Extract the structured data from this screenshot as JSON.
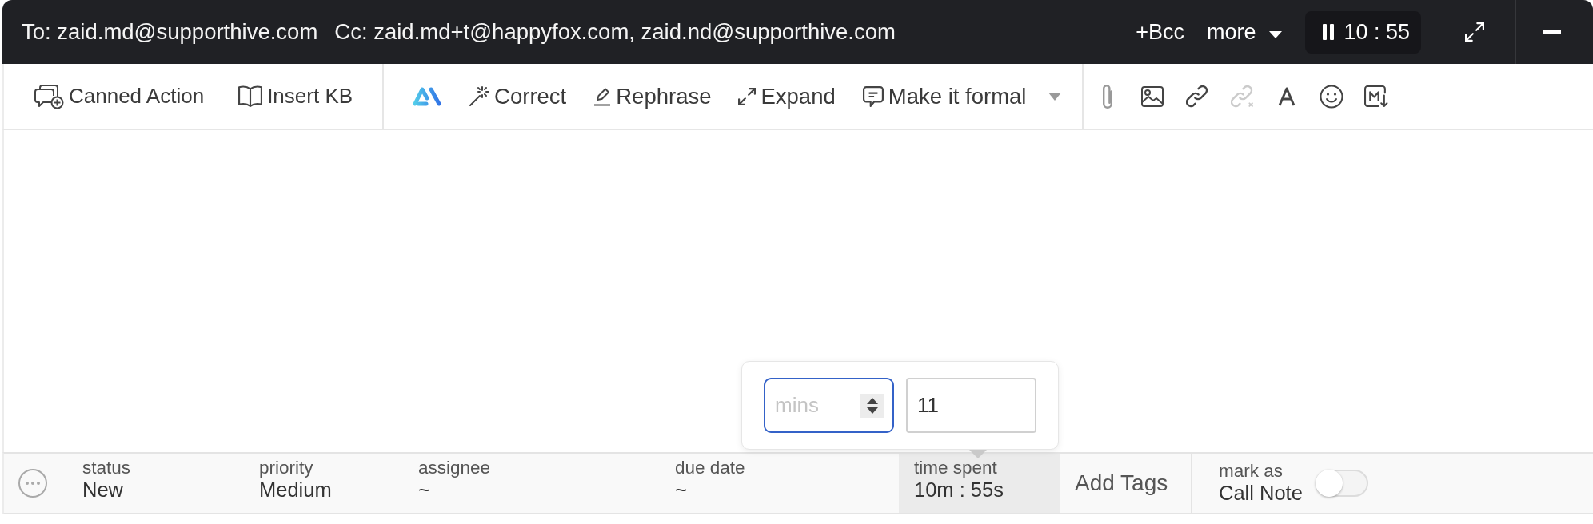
{
  "header": {
    "to": "To: zaid.md@supporthive.com",
    "cc": "Cc: zaid.md+t@happyfox.com, zaid.nd@supporthive.com",
    "bcc": "+Bcc",
    "more": "more",
    "timer": "10 : 55"
  },
  "toolbar": {
    "actions": [
      {
        "label": "Canned Action"
      },
      {
        "label": "Insert KB"
      }
    ],
    "ai_actions": [
      {
        "label": "Correct"
      },
      {
        "label": "Rephrase"
      },
      {
        "label": "Expand"
      },
      {
        "label": "Make it formal"
      }
    ],
    "format_tools": [
      {
        "disabled": false
      },
      {
        "disabled": false
      },
      {
        "disabled": false
      },
      {
        "disabled": true
      },
      {
        "disabled": false
      },
      {
        "disabled": false
      },
      {
        "disabled": false
      }
    ]
  },
  "ticket_fields": [
    {
      "label": "status",
      "value": "New",
      "active": false
    },
    {
      "label": "priority",
      "value": "Medium",
      "active": false
    },
    {
      "label": "assignee",
      "value": "~",
      "active": false
    },
    {
      "label": "due date",
      "value": "~",
      "active": false
    },
    {
      "label": "time spent",
      "value": "10m : 55s",
      "active": true
    }
  ],
  "add_tags": "Add Tags",
  "mark_as": {
    "label": "mark as",
    "value": "Call Note",
    "on": false
  },
  "time_popover": {
    "minutes": {
      "placeholder": "mins",
      "focused": true
    },
    "seconds": {
      "value": "11",
      "focused": false
    }
  }
}
